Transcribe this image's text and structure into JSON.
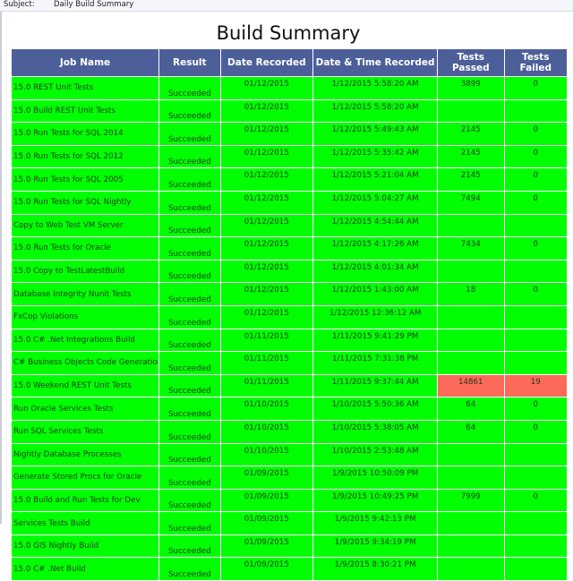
{
  "email": {
    "subject_label": "Subject:",
    "subject_value": "Daily Build Summary"
  },
  "report": {
    "title": "Build Summary",
    "columns": [
      "Job Name",
      "Result",
      "Date Recorded",
      "Date & Time Recorded",
      "Tests Passed",
      "Tests Failed"
    ],
    "rows": [
      {
        "job": "15.0 REST Unit Tests",
        "result": "Succeeded",
        "date": "01/12/2015",
        "datetime": "1/12/2015 5:58:20 AM",
        "passed": "3899",
        "failed": "0"
      },
      {
        "job": "15.0 Build REST Unit Tests",
        "result": "Succeeded",
        "date": "01/12/2015",
        "datetime": "1/12/2015 5:58:20 AM",
        "passed": "",
        "failed": ""
      },
      {
        "job": "15.0 Run Tests for SQL 2014",
        "result": "Succeeded",
        "date": "01/12/2015",
        "datetime": "1/12/2015 5:49:43 AM",
        "passed": "2145",
        "failed": "0"
      },
      {
        "job": "15.0 Run Tests for SQL 2012",
        "result": "Succeeded",
        "date": "01/12/2015",
        "datetime": "1/12/2015 5:35:42 AM",
        "passed": "2145",
        "failed": "0"
      },
      {
        "job": "15.0 Run Tests for SQL 2005",
        "result": "Succeeded",
        "date": "01/12/2015",
        "datetime": "1/12/2015 5:21:04 AM",
        "passed": "2145",
        "failed": "0"
      },
      {
        "job": "15.0 Run Tests for SQL Nightly",
        "result": "Succeeded",
        "date": "01/12/2015",
        "datetime": "1/12/2015 5:04:27 AM",
        "passed": "7494",
        "failed": "0"
      },
      {
        "job": "Copy to Web Test VM Server",
        "result": "Succeeded",
        "date": "01/12/2015",
        "datetime": "1/12/2015 4:54:44 AM",
        "passed": "",
        "failed": ""
      },
      {
        "job": "15.0 Run Tests for Oracle",
        "result": "Succeeded",
        "date": "01/12/2015",
        "datetime": "1/12/2015 4:17:26 AM",
        "passed": "7434",
        "failed": "0"
      },
      {
        "job": "15.0 Copy to TestLatestBuild",
        "result": "Succeeded",
        "date": "01/12/2015",
        "datetime": "1/12/2015 4:01:34 AM",
        "passed": "",
        "failed": ""
      },
      {
        "job": "Database Integrity Nunit Tests",
        "result": "Succeeded",
        "date": "01/12/2015",
        "datetime": "1/12/2015 1:43:00 AM",
        "passed": "18",
        "failed": "0"
      },
      {
        "job": "FxCop Violations",
        "result": "Succeeded",
        "date": "01/12/2015",
        "datetime": "1/12/2015 12:36:12 AM",
        "passed": "",
        "failed": ""
      },
      {
        "job": "15.0 C# .Net Integrations Build",
        "result": "Succeeded",
        "date": "01/11/2015",
        "datetime": "1/11/2015 9:41:29 PM",
        "passed": "",
        "failed": ""
      },
      {
        "job": "C# Business Objects Code Generation",
        "result": "Succeeded",
        "date": "01/11/2015",
        "datetime": "1/11/2015 7:31:38 PM",
        "passed": "",
        "failed": ""
      },
      {
        "job": "15.0 Weekend REST Unit Tests",
        "result": "Succeeded",
        "date": "01/11/2015",
        "datetime": "1/11/2015 9:37:44 AM",
        "passed": "14861",
        "failed": "19",
        "alert": true
      },
      {
        "job": "Run Oracle Services Tests",
        "result": "Succeeded",
        "date": "01/10/2015",
        "datetime": "1/10/2015 5:50:36 AM",
        "passed": "64",
        "failed": "0"
      },
      {
        "job": "Run SQL Services Tests",
        "result": "Succeeded",
        "date": "01/10/2015",
        "datetime": "1/10/2015 5:38:05 AM",
        "passed": "64",
        "failed": "0"
      },
      {
        "job": "Nightly Database Processes",
        "result": "Succeeded",
        "date": "01/10/2015",
        "datetime": "1/10/2015 2:53:48 AM",
        "passed": "",
        "failed": ""
      },
      {
        "job": "Generate Stored Procs for Oracle",
        "result": "Succeeded",
        "date": "01/09/2015",
        "datetime": "1/9/2015 10:50:09 PM",
        "passed": "",
        "failed": ""
      },
      {
        "job": "15.0 Build and Run Tests for Dev",
        "result": "Succeeded",
        "date": "01/09/2015",
        "datetime": "1/9/2015 10:49:25 PM",
        "passed": "7999",
        "failed": "0"
      },
      {
        "job": "Services Tests Build",
        "result": "Succeeded",
        "date": "01/09/2015",
        "datetime": "1/9/2015 9:42:13 PM",
        "passed": "",
        "failed": ""
      },
      {
        "job": "15.0 GIS Nightly Build",
        "result": "Succeeded",
        "date": "01/09/2015",
        "datetime": "1/9/2015 9:34:19 PM",
        "passed": "",
        "failed": ""
      },
      {
        "job": "15.0 C# .Net Build",
        "result": "Succeeded",
        "date": "01/09/2015",
        "datetime": "1/9/2015 8:30:21 PM",
        "passed": "",
        "failed": ""
      }
    ],
    "colors": {
      "header_bg": "#4d5f99",
      "success_bg": "#00ff00",
      "alert_bg": "#fe6a5a"
    }
  }
}
